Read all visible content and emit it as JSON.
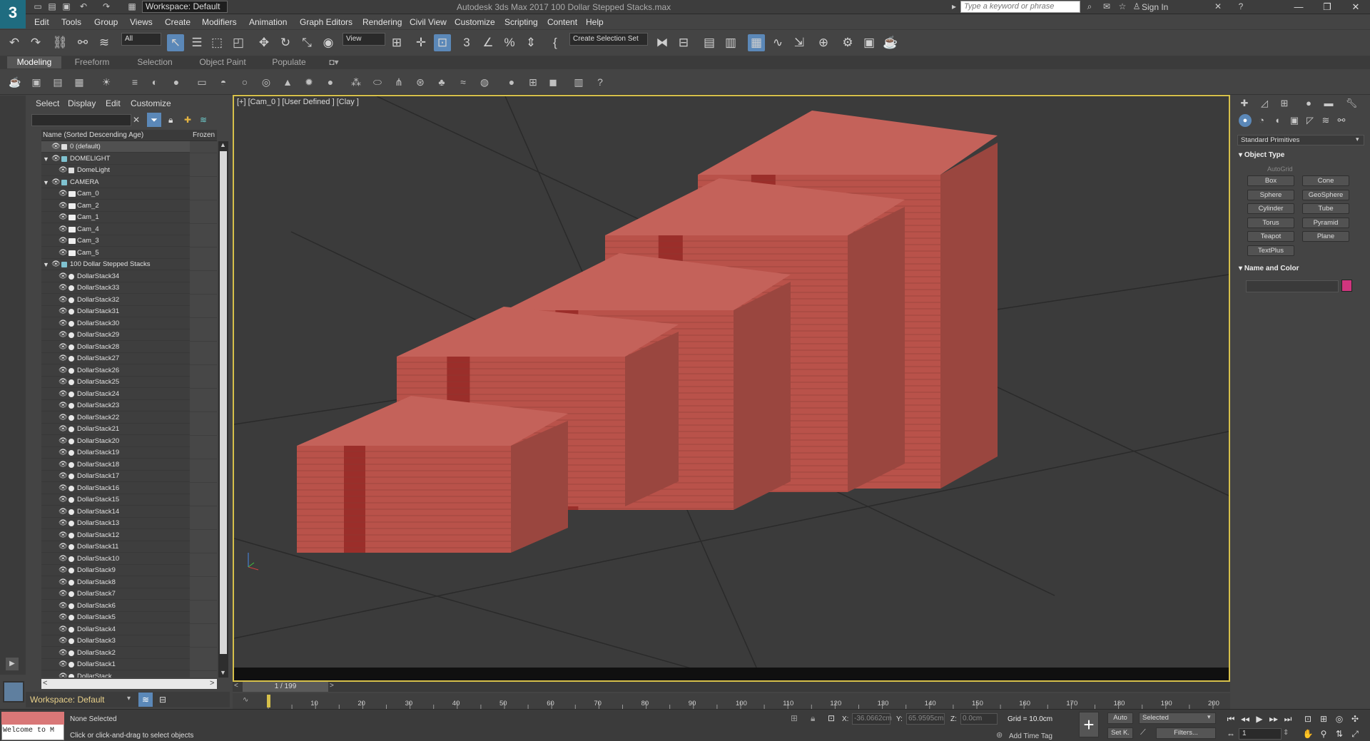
{
  "app": {
    "logo_text": "3",
    "title": "Autodesk 3ds Max 2017    100 Dollar Stepped Stacks.max",
    "workspace": "Workspace: Default",
    "search_placeholder": "Type a keyword or phrase",
    "sign_in": "Sign In"
  },
  "menus": [
    "Edit",
    "Tools",
    "Group",
    "Views",
    "Create",
    "Modifiers",
    "Animation",
    "Graph Editors",
    "Rendering",
    "Civil View",
    "Customize",
    "Scripting",
    "Content",
    "Help"
  ],
  "toolbar": {
    "selection_filter": "All",
    "ref_coord": "View",
    "named_selection": "Create Selection Set"
  },
  "ribbon_tabs": [
    "Modeling",
    "Freeform",
    "Selection",
    "Object Paint",
    "Populate"
  ],
  "scene_explorer": {
    "menu": [
      "Select",
      "Display",
      "Edit",
      "Customize"
    ],
    "col_name": "Name (Sorted Descending Age)",
    "col_frozen": "Frozen",
    "rows": [
      {
        "label": "0 (default)",
        "level": 1,
        "type": "layer",
        "expand": ""
      },
      {
        "label": "DOMELIGHT",
        "level": 0,
        "type": "layer",
        "expand": "▼"
      },
      {
        "label": "DomeLight",
        "level": 2,
        "type": "light",
        "expand": ""
      },
      {
        "label": "CAMERA",
        "level": 0,
        "type": "layer",
        "expand": "▼"
      },
      {
        "label": "Cam_0",
        "level": 2,
        "type": "camera",
        "expand": ""
      },
      {
        "label": "Cam_2",
        "level": 2,
        "type": "camera",
        "expand": ""
      },
      {
        "label": "Cam_1",
        "level": 2,
        "type": "camera",
        "expand": ""
      },
      {
        "label": "Cam_4",
        "level": 2,
        "type": "camera",
        "expand": ""
      },
      {
        "label": "Cam_3",
        "level": 2,
        "type": "camera",
        "expand": ""
      },
      {
        "label": "Cam_5",
        "level": 2,
        "type": "camera",
        "expand": ""
      },
      {
        "label": "100 Dollar Stepped Stacks",
        "level": 0,
        "type": "layer",
        "expand": "▼"
      },
      {
        "label": "DollarStack34",
        "level": 2,
        "type": "geo",
        "expand": ""
      },
      {
        "label": "DollarStack33",
        "level": 2,
        "type": "geo",
        "expand": ""
      },
      {
        "label": "DollarStack32",
        "level": 2,
        "type": "geo",
        "expand": ""
      },
      {
        "label": "DollarStack31",
        "level": 2,
        "type": "geo",
        "expand": ""
      },
      {
        "label": "DollarStack30",
        "level": 2,
        "type": "geo",
        "expand": ""
      },
      {
        "label": "DollarStack29",
        "level": 2,
        "type": "geo",
        "expand": ""
      },
      {
        "label": "DollarStack28",
        "level": 2,
        "type": "geo",
        "expand": ""
      },
      {
        "label": "DollarStack27",
        "level": 2,
        "type": "geo",
        "expand": ""
      },
      {
        "label": "DollarStack26",
        "level": 2,
        "type": "geo",
        "expand": ""
      },
      {
        "label": "DollarStack25",
        "level": 2,
        "type": "geo",
        "expand": ""
      },
      {
        "label": "DollarStack24",
        "level": 2,
        "type": "geo",
        "expand": ""
      },
      {
        "label": "DollarStack23",
        "level": 2,
        "type": "geo",
        "expand": ""
      },
      {
        "label": "DollarStack22",
        "level": 2,
        "type": "geo",
        "expand": ""
      },
      {
        "label": "DollarStack21",
        "level": 2,
        "type": "geo",
        "expand": ""
      },
      {
        "label": "DollarStack20",
        "level": 2,
        "type": "geo",
        "expand": ""
      },
      {
        "label": "DollarStack19",
        "level": 2,
        "type": "geo",
        "expand": ""
      },
      {
        "label": "DollarStack18",
        "level": 2,
        "type": "geo",
        "expand": ""
      },
      {
        "label": "DollarStack17",
        "level": 2,
        "type": "geo",
        "expand": ""
      },
      {
        "label": "DollarStack16",
        "level": 2,
        "type": "geo",
        "expand": ""
      },
      {
        "label": "DollarStack15",
        "level": 2,
        "type": "geo",
        "expand": ""
      },
      {
        "label": "DollarStack14",
        "level": 2,
        "type": "geo",
        "expand": ""
      },
      {
        "label": "DollarStack13",
        "level": 2,
        "type": "geo",
        "expand": ""
      },
      {
        "label": "DollarStack12",
        "level": 2,
        "type": "geo",
        "expand": ""
      },
      {
        "label": "DollarStack11",
        "level": 2,
        "type": "geo",
        "expand": ""
      },
      {
        "label": "DollarStack10",
        "level": 2,
        "type": "geo",
        "expand": ""
      },
      {
        "label": "DollarStack9",
        "level": 2,
        "type": "geo",
        "expand": ""
      },
      {
        "label": "DollarStack8",
        "level": 2,
        "type": "geo",
        "expand": ""
      },
      {
        "label": "DollarStack7",
        "level": 2,
        "type": "geo",
        "expand": ""
      },
      {
        "label": "DollarStack6",
        "level": 2,
        "type": "geo",
        "expand": ""
      },
      {
        "label": "DollarStack5",
        "level": 2,
        "type": "geo",
        "expand": ""
      },
      {
        "label": "DollarStack4",
        "level": 2,
        "type": "geo",
        "expand": ""
      },
      {
        "label": "DollarStack3",
        "level": 2,
        "type": "geo",
        "expand": ""
      },
      {
        "label": "DollarStack2",
        "level": 2,
        "type": "geo",
        "expand": ""
      },
      {
        "label": "DollarStack1",
        "level": 2,
        "type": "geo",
        "expand": ""
      },
      {
        "label": "DollarStack",
        "level": 2,
        "type": "geo",
        "expand": ""
      }
    ],
    "workspace_label": "Workspace: Default"
  },
  "viewport": {
    "label": "[+] [Cam_0 ] [User Defined ] [Clay ]",
    "stack_color": "#b9524a",
    "band_color": "#8e1f1c"
  },
  "command_panel": {
    "category": "Standard Primitives",
    "object_type_title": "Object Type",
    "autogrid": "AutoGrid",
    "buttons": [
      "Box",
      "Cone",
      "Sphere",
      "GeoSphere",
      "Cylinder",
      "Tube",
      "Torus",
      "Pyramid",
      "Teapot",
      "Plane",
      "TextPlus"
    ],
    "name_color_title": "Name and Color",
    "object_color": "#d0357e"
  },
  "timeline": {
    "frame_display": "1 / 199",
    "ticks": [
      "10",
      "20",
      "30",
      "40",
      "50",
      "60",
      "70",
      "80",
      "90",
      "100",
      "110",
      "120",
      "130",
      "140",
      "150",
      "160",
      "170",
      "180",
      "190",
      "200"
    ]
  },
  "status": {
    "maxscript": "Welcome to M",
    "selection": "None Selected",
    "prompt": "Click or click-and-drag to select objects",
    "x_label": "X:",
    "x_value": "-36.0662cm",
    "y_label": "Y:",
    "y_value": "65.9595cm",
    "z_label": "Z:",
    "z_value": "0.0cm",
    "grid": "Grid = 10.0cm",
    "add_time_tag": "Add Time Tag",
    "auto_key": "Auto",
    "set_key": "Set K.",
    "key_filter": "Selected",
    "filters": "Filters...",
    "frame": "1"
  }
}
